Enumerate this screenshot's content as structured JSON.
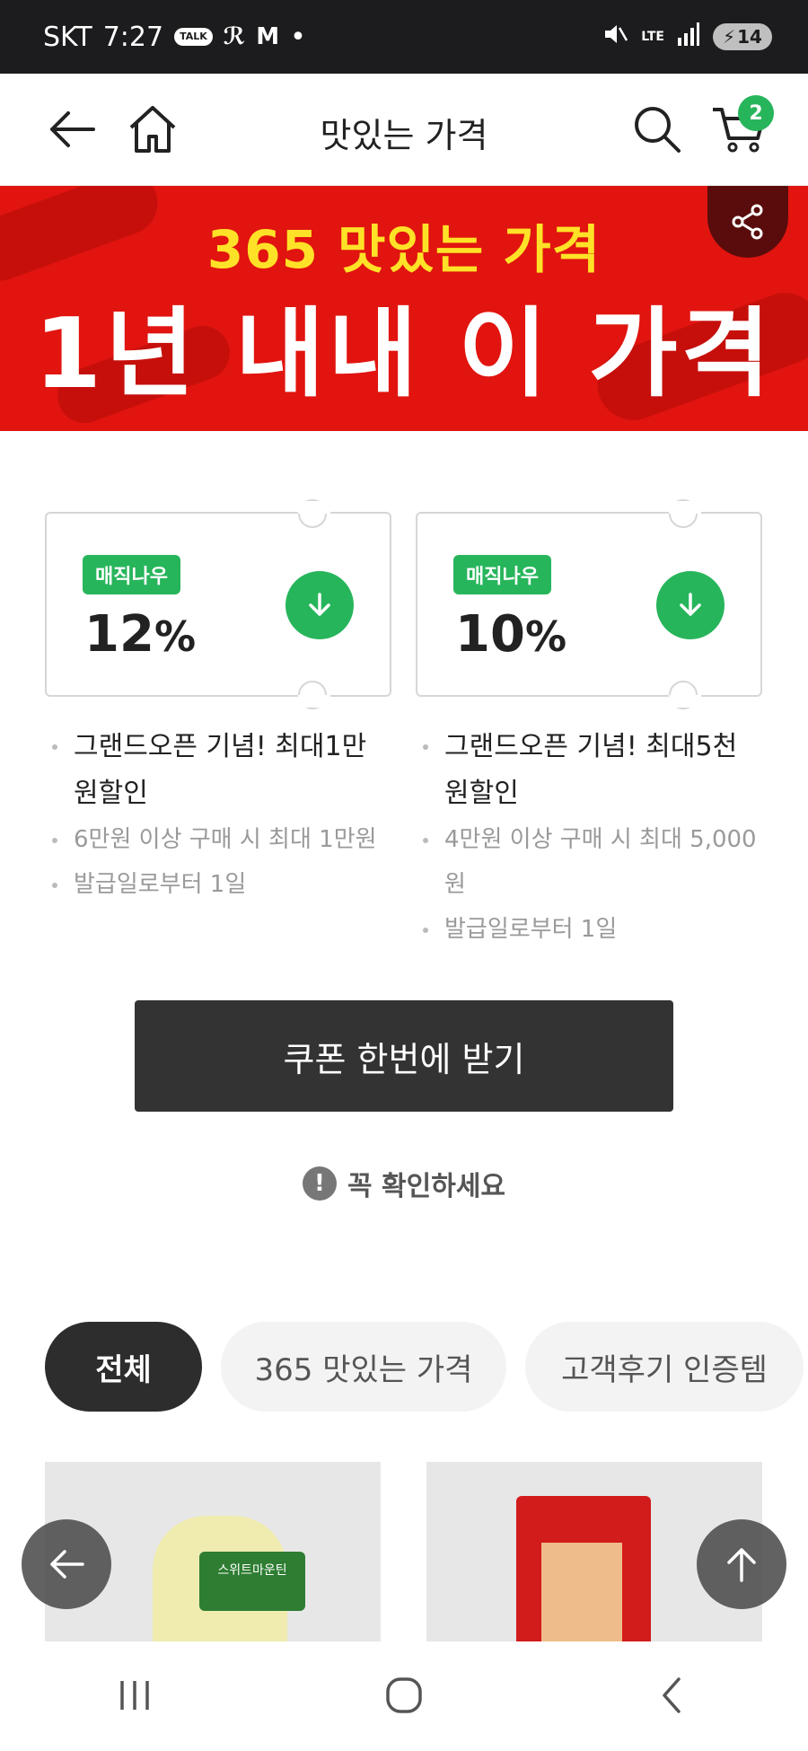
{
  "status_bar": {
    "carrier": "SKT",
    "time": "7:27",
    "app_icons": [
      "kakaotalk-icon",
      "app-k-icon",
      "gmail-icon",
      "dot-icon"
    ],
    "talk_label": "TALK",
    "network": "LTE",
    "battery": "14"
  },
  "header": {
    "title": "맛있는 가격",
    "cart_count": "2"
  },
  "banner": {
    "subtitle": "365 맛있는 가격",
    "headline": "1년 내내 이 가격",
    "bg_color": "#e1140f",
    "subtitle_color": "#ffe227"
  },
  "coupons": [
    {
      "tag": "매직나우",
      "percent": "12",
      "symbol": "%",
      "title": "그랜드오픈 기념! 최대1만원할인",
      "conditions": [
        "6만원 이상 구매 시 최대 1만원",
        "발급일로부터 1일"
      ]
    },
    {
      "tag": "매직나우",
      "percent": "10",
      "symbol": "%",
      "title": "그랜드오픈 기념! 최대5천원할인",
      "conditions": [
        "4만원 이상 구매 시 최대 5,000원",
        "발급일로부터 1일"
      ]
    }
  ],
  "coupon_all_button": "쿠폰 한번에 받기",
  "notice": "꼭 확인하세요",
  "tabs": [
    {
      "label": "전체",
      "active": true
    },
    {
      "label": "365 맛있는 가격",
      "active": false
    },
    {
      "label": "고객후기 인증템",
      "active": false
    }
  ],
  "products": [
    {
      "image_label": "스위트마운틴",
      "image_icon": "cabbage-product-image"
    },
    {
      "image_icon": "bagged-product-image"
    }
  ],
  "accent_color": "#27b55b"
}
